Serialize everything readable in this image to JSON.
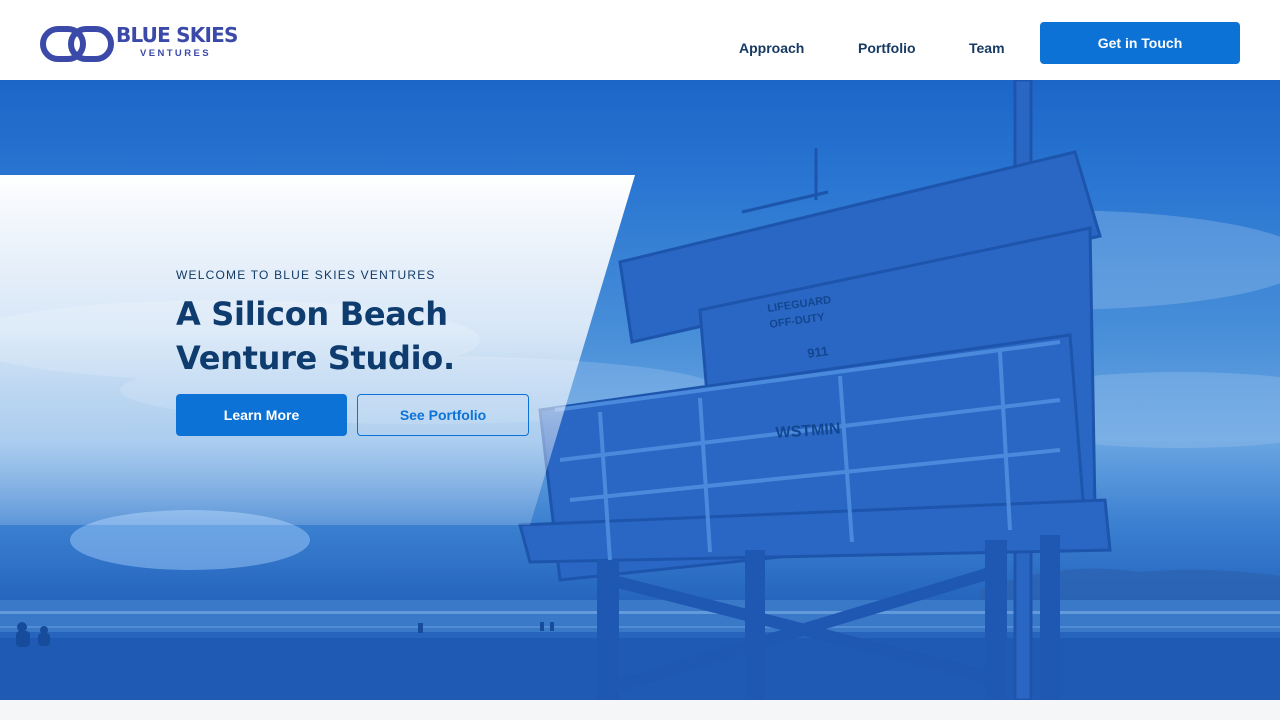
{
  "brand": {
    "name": "BLUE SKIES",
    "sub": "VENTURES",
    "color": "#3b4aa8"
  },
  "nav": {
    "items": [
      {
        "label": "Approach"
      },
      {
        "label": "Portfolio"
      },
      {
        "label": "Team"
      }
    ],
    "cta_label": "Get in Touch"
  },
  "hero": {
    "eyebrow": "WELCOME TO BLUE SKIES VENTURES",
    "title_line1": "A Silicon Beach",
    "title_line2": "Venture Studio.",
    "primary_button": "Learn More",
    "secondary_button": "See Portfolio",
    "tower_signs": [
      "LIFEGUARD",
      "OFF-DUTY",
      "911",
      "WSTMIN"
    ]
  },
  "colors": {
    "accent": "#0d72d6",
    "heading": "#0f3c6e",
    "nav_text": "#163a63",
    "hero_overlay": "#1c5fc0"
  },
  "icons": {
    "logo_mark": "linked-rings-icon"
  }
}
